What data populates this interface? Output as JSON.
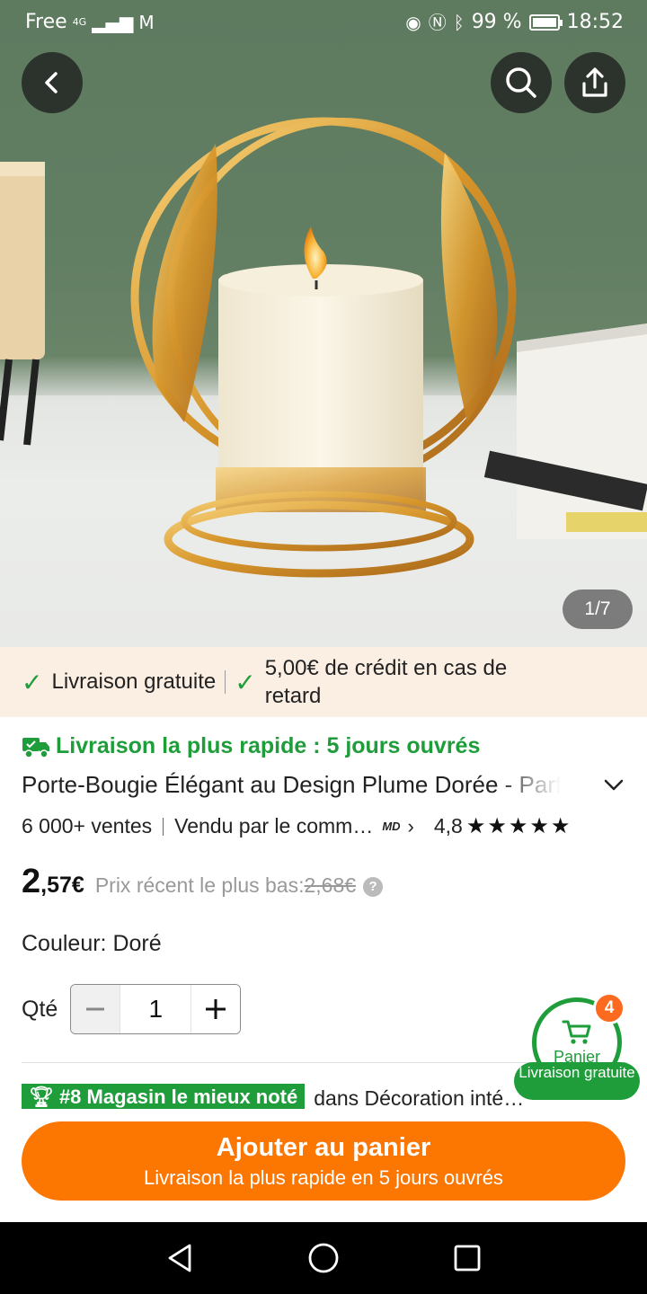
{
  "status_bar": {
    "carrier": "Free",
    "network": "4G",
    "battery": "99 %",
    "time": "18:52"
  },
  "gallery": {
    "counter": "1/7"
  },
  "benefits": {
    "item1": "Livraison gratuite",
    "item2": "5,00€ de crédit en cas de retard"
  },
  "product": {
    "fast_shipping": "Livraison la plus rapide : 5 jours ouvrés",
    "title": "Porte-Bougie Élégant au Design Plume Dorée - Parfait pour la décoration",
    "sales": "6 000+ ventes",
    "seller": "Vendu par le comm…",
    "seller_badge": "MD",
    "rating": "4,8",
    "stars": 5,
    "price_int": "2",
    "price_dec": ",57€",
    "price_note": "Prix récent le plus bas:",
    "price_old": "2,68€",
    "color_label": "Couleur: Doré",
    "qty_label": "Qté",
    "qty_value": "1",
    "rank_badge": "#8 Magasin le mieux noté",
    "rank_text": "dans Décoration inté…"
  },
  "cart": {
    "count": "4",
    "label": "Panier",
    "pill": "Livraison gratuite"
  },
  "cta": {
    "main": "Ajouter au panier",
    "sub": "Livraison la plus rapide en 5 jours ouvrés"
  },
  "colors": {
    "green": "#1f9d3b",
    "orange": "#fb7701",
    "banner_bg": "#fbeee3",
    "badge_orange": "#fb6a1f"
  }
}
